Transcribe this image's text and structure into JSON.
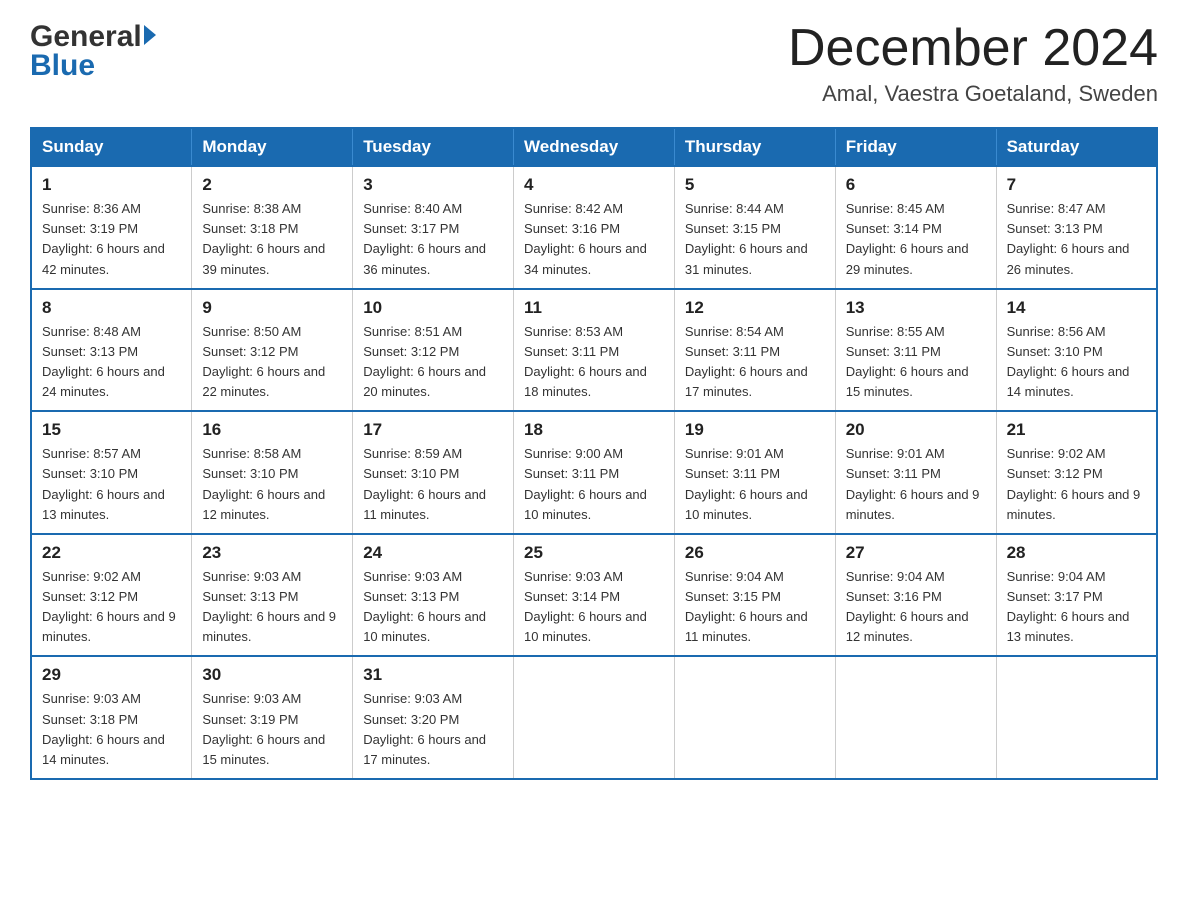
{
  "header": {
    "logo_general": "General",
    "logo_blue": "Blue",
    "month_title": "December 2024",
    "location": "Amal, Vaestra Goetaland, Sweden"
  },
  "days_of_week": [
    "Sunday",
    "Monday",
    "Tuesday",
    "Wednesday",
    "Thursday",
    "Friday",
    "Saturday"
  ],
  "weeks": [
    [
      {
        "day": "1",
        "sunrise": "Sunrise: 8:36 AM",
        "sunset": "Sunset: 3:19 PM",
        "daylight": "Daylight: 6 hours and 42 minutes."
      },
      {
        "day": "2",
        "sunrise": "Sunrise: 8:38 AM",
        "sunset": "Sunset: 3:18 PM",
        "daylight": "Daylight: 6 hours and 39 minutes."
      },
      {
        "day": "3",
        "sunrise": "Sunrise: 8:40 AM",
        "sunset": "Sunset: 3:17 PM",
        "daylight": "Daylight: 6 hours and 36 minutes."
      },
      {
        "day": "4",
        "sunrise": "Sunrise: 8:42 AM",
        "sunset": "Sunset: 3:16 PM",
        "daylight": "Daylight: 6 hours and 34 minutes."
      },
      {
        "day": "5",
        "sunrise": "Sunrise: 8:44 AM",
        "sunset": "Sunset: 3:15 PM",
        "daylight": "Daylight: 6 hours and 31 minutes."
      },
      {
        "day": "6",
        "sunrise": "Sunrise: 8:45 AM",
        "sunset": "Sunset: 3:14 PM",
        "daylight": "Daylight: 6 hours and 29 minutes."
      },
      {
        "day": "7",
        "sunrise": "Sunrise: 8:47 AM",
        "sunset": "Sunset: 3:13 PM",
        "daylight": "Daylight: 6 hours and 26 minutes."
      }
    ],
    [
      {
        "day": "8",
        "sunrise": "Sunrise: 8:48 AM",
        "sunset": "Sunset: 3:13 PM",
        "daylight": "Daylight: 6 hours and 24 minutes."
      },
      {
        "day": "9",
        "sunrise": "Sunrise: 8:50 AM",
        "sunset": "Sunset: 3:12 PM",
        "daylight": "Daylight: 6 hours and 22 minutes."
      },
      {
        "day": "10",
        "sunrise": "Sunrise: 8:51 AM",
        "sunset": "Sunset: 3:12 PM",
        "daylight": "Daylight: 6 hours and 20 minutes."
      },
      {
        "day": "11",
        "sunrise": "Sunrise: 8:53 AM",
        "sunset": "Sunset: 3:11 PM",
        "daylight": "Daylight: 6 hours and 18 minutes."
      },
      {
        "day": "12",
        "sunrise": "Sunrise: 8:54 AM",
        "sunset": "Sunset: 3:11 PM",
        "daylight": "Daylight: 6 hours and 17 minutes."
      },
      {
        "day": "13",
        "sunrise": "Sunrise: 8:55 AM",
        "sunset": "Sunset: 3:11 PM",
        "daylight": "Daylight: 6 hours and 15 minutes."
      },
      {
        "day": "14",
        "sunrise": "Sunrise: 8:56 AM",
        "sunset": "Sunset: 3:10 PM",
        "daylight": "Daylight: 6 hours and 14 minutes."
      }
    ],
    [
      {
        "day": "15",
        "sunrise": "Sunrise: 8:57 AM",
        "sunset": "Sunset: 3:10 PM",
        "daylight": "Daylight: 6 hours and 13 minutes."
      },
      {
        "day": "16",
        "sunrise": "Sunrise: 8:58 AM",
        "sunset": "Sunset: 3:10 PM",
        "daylight": "Daylight: 6 hours and 12 minutes."
      },
      {
        "day": "17",
        "sunrise": "Sunrise: 8:59 AM",
        "sunset": "Sunset: 3:10 PM",
        "daylight": "Daylight: 6 hours and 11 minutes."
      },
      {
        "day": "18",
        "sunrise": "Sunrise: 9:00 AM",
        "sunset": "Sunset: 3:11 PM",
        "daylight": "Daylight: 6 hours and 10 minutes."
      },
      {
        "day": "19",
        "sunrise": "Sunrise: 9:01 AM",
        "sunset": "Sunset: 3:11 PM",
        "daylight": "Daylight: 6 hours and 10 minutes."
      },
      {
        "day": "20",
        "sunrise": "Sunrise: 9:01 AM",
        "sunset": "Sunset: 3:11 PM",
        "daylight": "Daylight: 6 hours and 9 minutes."
      },
      {
        "day": "21",
        "sunrise": "Sunrise: 9:02 AM",
        "sunset": "Sunset: 3:12 PM",
        "daylight": "Daylight: 6 hours and 9 minutes."
      }
    ],
    [
      {
        "day": "22",
        "sunrise": "Sunrise: 9:02 AM",
        "sunset": "Sunset: 3:12 PM",
        "daylight": "Daylight: 6 hours and 9 minutes."
      },
      {
        "day": "23",
        "sunrise": "Sunrise: 9:03 AM",
        "sunset": "Sunset: 3:13 PM",
        "daylight": "Daylight: 6 hours and 9 minutes."
      },
      {
        "day": "24",
        "sunrise": "Sunrise: 9:03 AM",
        "sunset": "Sunset: 3:13 PM",
        "daylight": "Daylight: 6 hours and 10 minutes."
      },
      {
        "day": "25",
        "sunrise": "Sunrise: 9:03 AM",
        "sunset": "Sunset: 3:14 PM",
        "daylight": "Daylight: 6 hours and 10 minutes."
      },
      {
        "day": "26",
        "sunrise": "Sunrise: 9:04 AM",
        "sunset": "Sunset: 3:15 PM",
        "daylight": "Daylight: 6 hours and 11 minutes."
      },
      {
        "day": "27",
        "sunrise": "Sunrise: 9:04 AM",
        "sunset": "Sunset: 3:16 PM",
        "daylight": "Daylight: 6 hours and 12 minutes."
      },
      {
        "day": "28",
        "sunrise": "Sunrise: 9:04 AM",
        "sunset": "Sunset: 3:17 PM",
        "daylight": "Daylight: 6 hours and 13 minutes."
      }
    ],
    [
      {
        "day": "29",
        "sunrise": "Sunrise: 9:03 AM",
        "sunset": "Sunset: 3:18 PM",
        "daylight": "Daylight: 6 hours and 14 minutes."
      },
      {
        "day": "30",
        "sunrise": "Sunrise: 9:03 AM",
        "sunset": "Sunset: 3:19 PM",
        "daylight": "Daylight: 6 hours and 15 minutes."
      },
      {
        "day": "31",
        "sunrise": "Sunrise: 9:03 AM",
        "sunset": "Sunset: 3:20 PM",
        "daylight": "Daylight: 6 hours and 17 minutes."
      },
      null,
      null,
      null,
      null
    ]
  ]
}
